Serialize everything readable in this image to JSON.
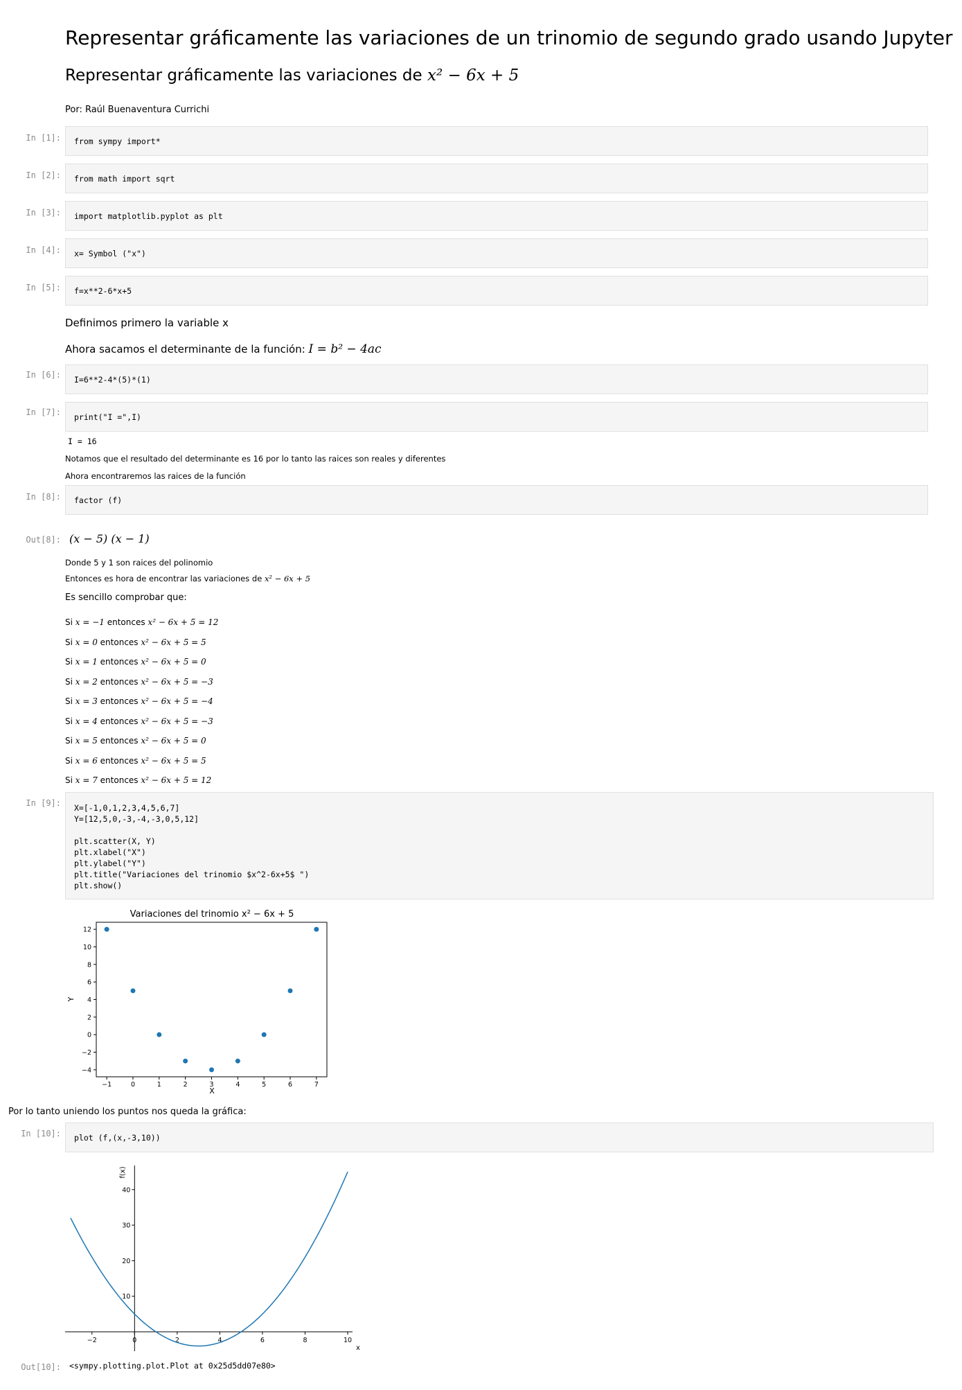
{
  "title": "Representar gráficamente las variaciones de un trinomio de segundo grado usando Jupyter",
  "subtitle_prefix": "Representar gráficamente las variaciones de ",
  "subtitle_math": "x² − 6x + 5",
  "author": "Por: Raúl Buenaventura Currichi",
  "cells": [
    {
      "prompt": "In [1]:",
      "code": "from sympy import*"
    },
    {
      "prompt": "In [2]:",
      "code": "from math import sqrt"
    },
    {
      "prompt": "In [3]:",
      "code": "import matplotlib.pyplot as plt"
    },
    {
      "prompt": "In [4]:",
      "code": "x= Symbol (\"x\")"
    },
    {
      "prompt": "In [5]:",
      "code": "f=x**2-6*x+5"
    },
    {
      "prompt": "In [6]:",
      "code": "I=6**2-4*(5)*(1)"
    },
    {
      "prompt": "In [7]:",
      "code": "print(\"I =\",I)"
    },
    {
      "prompt": "In [8]:",
      "code": "factor (f)"
    },
    {
      "prompt": "In [9]:",
      "code": "X=[-1,0,1,2,3,4,5,6,7]\nY=[12,5,0,-3,-4,-3,0,5,12]\n\nplt.scatter(X, Y)\nplt.xlabel(\"X\")\nplt.ylabel(\"Y\")\nplt.title(\"Variaciones del trinomio $x^2-6x+5$ \")\nplt.show()"
    },
    {
      "prompt": "In [10]:",
      "code": "plot (f,(x,-3,10))"
    }
  ],
  "md1": "Definimos primero la variable x",
  "md2_prefix": "Ahora sacamos el determinante de la función: ",
  "md2_math": "I = b² − 4ac",
  "out7": "I = 16",
  "note1": "Notamos que el resultado del determinante es 16 por lo tanto las raices son reales y diferentes",
  "note2": "Ahora encontraremos las raices de la función",
  "out8_prompt": "Out[8]:",
  "out8": "(x − 5) (x − 1)",
  "note3": "Donde 5 y 1 son raices del polinomio",
  "note4_prefix": "Entonces es hora de encontrar las variaciones de ",
  "note4_math": "x² − 6x + 5",
  "easy": "Es sencillo comprobar que:",
  "checks": [
    {
      "x": "x = −1",
      "val": "x² − 6x + 5 = 12"
    },
    {
      "x": "x = 0",
      "val": "x² − 6x + 5 = 5"
    },
    {
      "x": "x = 1",
      "val": "x² − 6x + 5 = 0"
    },
    {
      "x": "x = 2",
      "val": "x² − 6x + 5 = −3"
    },
    {
      "x": "x = 3",
      "val": "x² − 6x + 5 = −4"
    },
    {
      "x": "x = 4",
      "val": "x² − 6x + 5 = −3"
    },
    {
      "x": "x = 5",
      "val": "x² − 6x + 5 = 0"
    },
    {
      "x": "x = 6",
      "val": "x² − 6x + 5 = 5"
    },
    {
      "x": "x = 7",
      "val": "x² − 6x + 5 = 12"
    }
  ],
  "si": "Si ",
  "entonces": " entonces ",
  "unify": "Por lo tanto uniendo los puntos nos queda la gráfica:",
  "out10_prompt": "Out[10]:",
  "out10": "<sympy.plotting.plot.Plot at 0x25d5dd07e80>",
  "colors": {
    "series": "#1f77b4",
    "keyword": "#008000",
    "string": "#ba2121"
  },
  "chart_data": [
    {
      "type": "scatter",
      "title": "Variaciones del trinomio x² − 6x + 5",
      "xlabel": "X",
      "ylabel": "Y",
      "x": [
        -1,
        0,
        1,
        2,
        3,
        4,
        5,
        6,
        7
      ],
      "y": [
        12,
        5,
        0,
        -3,
        -4,
        -3,
        0,
        5,
        12
      ],
      "xlim": [
        -1.4,
        7.4
      ],
      "ylim": [
        -4.8,
        12.8
      ],
      "xticks": [
        "−1",
        "0",
        "1",
        "2",
        "3",
        "4",
        "5",
        "6",
        "7"
      ],
      "yticks": [
        "12",
        "10",
        "8",
        "6",
        "4",
        "2",
        "0",
        "−2",
        "−4"
      ]
    },
    {
      "type": "line",
      "xlabel": "x",
      "ylabel": "f(x)",
      "function": "x**2-6*x+5",
      "xrange": [
        -3,
        10
      ],
      "xticks": [
        "−2",
        "0",
        "2",
        "4",
        "6",
        "8",
        "10"
      ],
      "yticks": [
        "10",
        "20",
        "30",
        "40"
      ]
    }
  ]
}
